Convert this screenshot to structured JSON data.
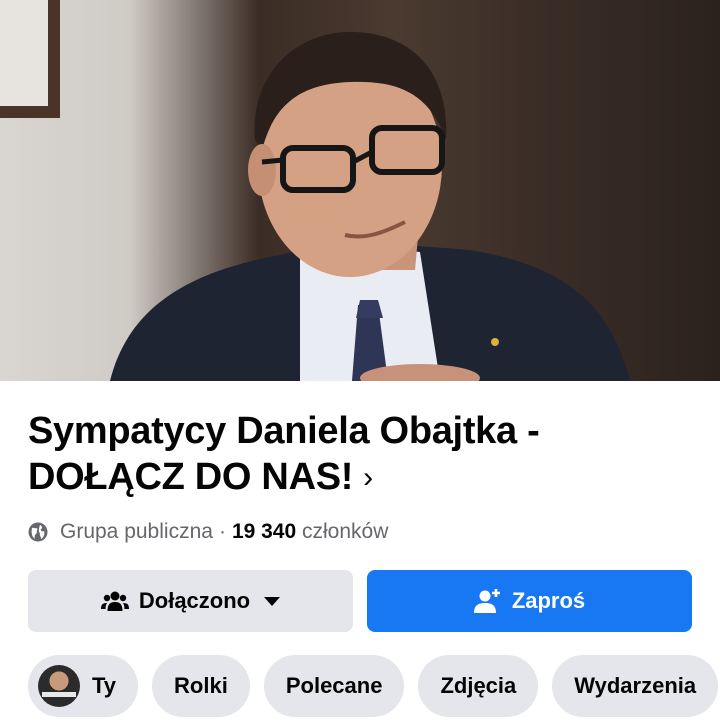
{
  "group": {
    "title": "Sympatycy Daniela Obajtka - DOŁĄCZ DO NAS!",
    "privacy": "Grupa publiczna",
    "separator": "·",
    "member_count": "19 340",
    "member_label": "członków"
  },
  "actions": {
    "joined_label": "Dołączono",
    "invite_label": "Zaproś"
  },
  "tabs": [
    {
      "label": "Ty"
    },
    {
      "label": "Rolki"
    },
    {
      "label": "Polecane"
    },
    {
      "label": "Zdjęcia"
    },
    {
      "label": "Wydarzenia"
    }
  ],
  "colors": {
    "primary": "#1877f2",
    "secondary_bg": "#e4e6eb",
    "text": "#050505",
    "muted": "#65676b"
  },
  "icons": [
    "globe-icon",
    "group-members-icon",
    "caret-down-icon",
    "add-person-icon",
    "chevron-right-icon"
  ]
}
